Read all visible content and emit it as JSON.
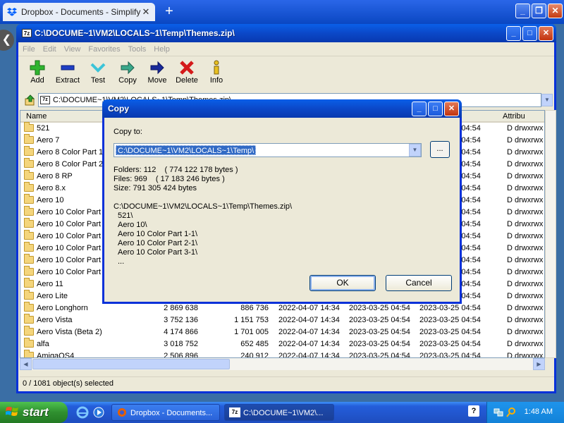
{
  "browser": {
    "tab_title": "Dropbox - Documents - Simplify yo",
    "tab_close": "✕",
    "new_tab": "+",
    "controls": {
      "minimize": "_",
      "restore": "❐",
      "close": "✕"
    }
  },
  "window": {
    "title": "C:\\DOCUME~1\\VM2\\LOCALS~1\\Temp\\Themes.zip\\",
    "app_icon": "7z",
    "controls": {
      "minimize": "_",
      "maximize": "□",
      "close": "✕"
    },
    "menu": [
      "File",
      "Edit",
      "View",
      "Favorites",
      "Tools",
      "Help"
    ],
    "toolbar": [
      {
        "label": "Add",
        "icon": "add-icon"
      },
      {
        "label": "Extract",
        "icon": "extract-icon"
      },
      {
        "label": "Test",
        "icon": "test-icon"
      },
      {
        "label": "Copy",
        "icon": "copy-icon"
      },
      {
        "label": "Move",
        "icon": "move-icon"
      },
      {
        "label": "Delete",
        "icon": "delete-icon"
      },
      {
        "label": "Info",
        "icon": "info-icon"
      }
    ],
    "address": "C:\\DOCUME~1\\VM2\\LOCALS~1\\Temp\\Themes.zip\\",
    "columns": {
      "name": "Name",
      "attributes": "Attribu"
    },
    "rows": [
      {
        "name": "521",
        "size": "",
        "packed": "",
        "modified": "",
        "created": "",
        "accessed": "2023-03-25 04:54",
        "attr": "D drwxrwx"
      },
      {
        "name": "Aero 7",
        "size": "",
        "packed": "",
        "modified": "",
        "created": "",
        "accessed": "2023-03-25 04:54",
        "attr": "D drwxrwx"
      },
      {
        "name": "Aero 8 Color Part 1",
        "size": "",
        "packed": "",
        "modified": "",
        "created": "",
        "accessed": "2023-03-25 04:54",
        "attr": "D drwxrwx"
      },
      {
        "name": "Aero 8 Color Part 2",
        "size": "",
        "packed": "",
        "modified": "",
        "created": "",
        "accessed": "2023-03-25 04:54",
        "attr": "D drwxrwx"
      },
      {
        "name": "Aero 8 RP",
        "size": "",
        "packed": "",
        "modified": "",
        "created": "",
        "accessed": "2023-03-25 04:54",
        "attr": "D drwxrwx"
      },
      {
        "name": "Aero 8.x",
        "size": "",
        "packed": "",
        "modified": "",
        "created": "",
        "accessed": "2023-03-25 04:54",
        "attr": "D drwxrwx"
      },
      {
        "name": "Aero 10",
        "size": "",
        "packed": "",
        "modified": "",
        "created": "",
        "accessed": "2023-03-25 04:54",
        "attr": "D drwxrwx"
      },
      {
        "name": "Aero 10 Color Part 1",
        "size": "",
        "packed": "",
        "modified": "",
        "created": "",
        "accessed": "2023-03-25 04:54",
        "attr": "D drwxrwx"
      },
      {
        "name": "Aero 10 Color Part 2",
        "size": "",
        "packed": "",
        "modified": "",
        "created": "",
        "accessed": "2023-03-25 04:54",
        "attr": "D drwxrwx"
      },
      {
        "name": "Aero 10 Color Part 3",
        "size": "",
        "packed": "",
        "modified": "",
        "created": "",
        "accessed": "2023-03-25 04:54",
        "attr": "D drwxrwx"
      },
      {
        "name": "Aero 10 Color Part 4",
        "size": "",
        "packed": "",
        "modified": "",
        "created": "",
        "accessed": "2023-03-25 04:54",
        "attr": "D drwxrwx"
      },
      {
        "name": "Aero 10 Color Part 5",
        "size": "",
        "packed": "",
        "modified": "",
        "created": "",
        "accessed": "2023-03-25 04:54",
        "attr": "D drwxrwx"
      },
      {
        "name": "Aero 10 Color Part 6",
        "size": "",
        "packed": "",
        "modified": "",
        "created": "",
        "accessed": "2023-03-25 04:54",
        "attr": "D drwxrwx"
      },
      {
        "name": "Aero 11",
        "size": "",
        "packed": "",
        "modified": "",
        "created": "",
        "accessed": "2023-03-25 04:54",
        "attr": "D drwxrwx"
      },
      {
        "name": "Aero Lite",
        "size": "",
        "packed": "",
        "modified": "",
        "created": "",
        "accessed": "2023-03-25 04:54",
        "attr": "D drwxrwx"
      },
      {
        "name": "Aero Longhorn",
        "size": "2 869 638",
        "packed": "886 736",
        "modified": "2022-04-07 14:34",
        "created": "2023-03-25 04:54",
        "accessed": "2023-03-25 04:54",
        "attr": "D drwxrwx"
      },
      {
        "name": "Aero Vista",
        "size": "3 752 136",
        "packed": "1 151 753",
        "modified": "2022-04-07 14:34",
        "created": "2023-03-25 04:54",
        "accessed": "2023-03-25 04:54",
        "attr": "D drwxrwx"
      },
      {
        "name": "Aero Vista (Beta 2)",
        "size": "4 174 866",
        "packed": "1 701 005",
        "modified": "2022-04-07 14:34",
        "created": "2023-03-25 04:54",
        "accessed": "2023-03-25 04:54",
        "attr": "D drwxrwx"
      },
      {
        "name": "alfa",
        "size": "3 018 752",
        "packed": "652 485",
        "modified": "2022-04-07 14:34",
        "created": "2023-03-25 04:54",
        "accessed": "2023-03-25 04:54",
        "attr": "D drwxrwx"
      },
      {
        "name": "AmigaOS4",
        "size": "2 506 896",
        "packed": "240 912",
        "modified": "2022-04-07 14:34",
        "created": "2023-03-25 04:54",
        "accessed": "2023-03-25 04:54",
        "attr": "D drwxrwx"
      }
    ],
    "status": "0 / 1081 object(s) selected"
  },
  "dialog": {
    "title": "Copy",
    "copy_to_label": "Copy to:",
    "destination": "C:\\DOCUME~1\\VM2\\LOCALS~1\\Temp\\",
    "browse_label": "...",
    "folders": "Folders: 112    ( 774 122 178 bytes )",
    "files": "Files: 969    ( 17 183 246 bytes )",
    "size": "Size: 791 305 424 bytes",
    "source_path": "C:\\DOCUME~1\\VM2\\LOCALS~1\\Temp\\Themes.zip\\",
    "items": [
      "521\\",
      "Aero 10\\",
      "Aero 10 Color Part 1-1\\",
      "Aero 10 Color Part 2-1\\",
      "Aero 10 Color Part 3-1\\",
      "..."
    ],
    "ok_label": "OK",
    "cancel_label": "Cancel"
  },
  "taskbar": {
    "start_label": "start",
    "tasks": [
      {
        "label": "Dropbox - Documents...",
        "active": false
      },
      {
        "label": "C:\\DOCUME~1\\VM2\\...",
        "active": true
      }
    ],
    "help": "?",
    "clock": "1:48 AM"
  }
}
